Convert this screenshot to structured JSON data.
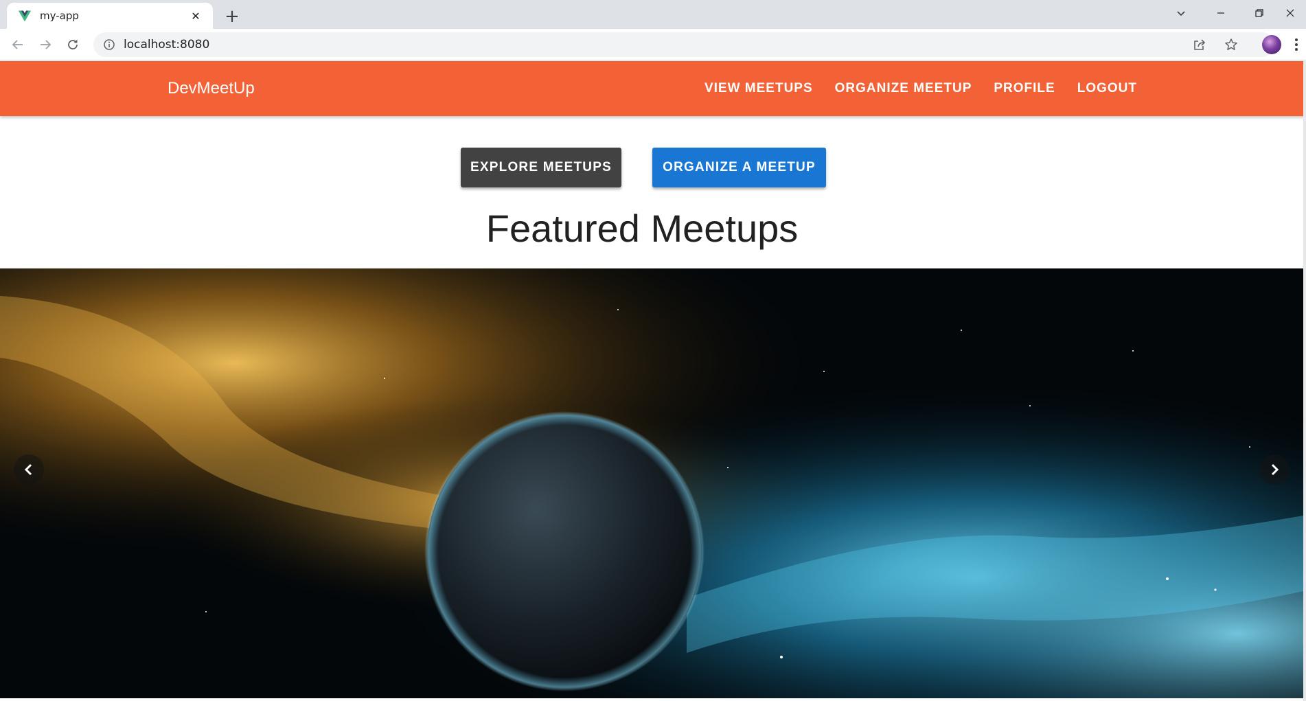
{
  "browser": {
    "tab": {
      "title": "my-app",
      "favicon": "vue-logo-icon",
      "close_icon": "close-icon"
    },
    "new_tab_icon": "plus-icon",
    "window_controls": [
      "chevron-down-icon",
      "minimize-icon",
      "restore-icon",
      "close-icon"
    ],
    "toolbar": {
      "back_icon": "arrow-left-icon",
      "forward_icon": "arrow-right-icon",
      "reload_icon": "reload-icon",
      "site_info_icon": "info-icon",
      "url": "localhost:8080",
      "share_icon": "share-icon",
      "bookmark_icon": "star-icon",
      "profile_icon": "avatar",
      "menu_icon": "kebab-menu-icon"
    }
  },
  "app": {
    "brand": "DevMeetUp",
    "nav": [
      {
        "label": "VIEW MEETUPS"
      },
      {
        "label": "ORGANIZE MEETUP"
      },
      {
        "label": "PROFILE"
      },
      {
        "label": "LOGOUT"
      }
    ],
    "colors": {
      "appbar": "#f26236",
      "explore_button": "#424242",
      "organize_button": "#1976d2"
    }
  },
  "main": {
    "explore_button": "EXPLORE MEETUPS",
    "organize_button": "ORGANIZE A MEETUP",
    "title": "Featured Meetups",
    "carousel": {
      "prev_icon": "chevron-left-icon",
      "next_icon": "chevron-right-icon",
      "slide_image": "space-planet-nebula"
    }
  }
}
